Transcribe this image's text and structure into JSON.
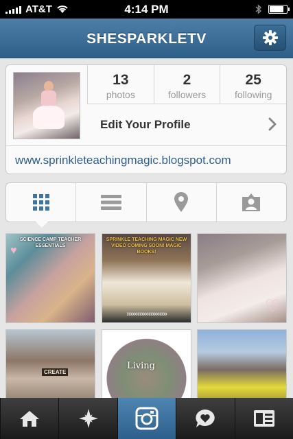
{
  "status_bar": {
    "carrier": "AT&T",
    "time": "4:14 PM",
    "battery_level": 0.82
  },
  "navbar": {
    "title": "SHESPARKLETV",
    "settings_icon": "gear-icon"
  },
  "profile": {
    "stats": [
      {
        "value": "13",
        "label": "photos"
      },
      {
        "value": "2",
        "label": "followers"
      },
      {
        "value": "25",
        "label": "following"
      }
    ],
    "edit_label": "Edit Your Profile",
    "website": "www.sprinkleteachingmagic.blogspot.com"
  },
  "view_tabs": {
    "icons": [
      "grid-icon",
      "list-icon",
      "location-pin-icon",
      "tagged-person-icon"
    ],
    "active": "grid-icon"
  },
  "photos": [
    {
      "caption": "SCIENCE CAMP TEACHER ESSENTIALS"
    },
    {
      "caption": "SPRINKLE TEACHING MAGIC NEW VIDEO COMING SOON! MAGIC BOOKS!"
    },
    {
      "caption": ""
    },
    {
      "caption": "",
      "sign": "CREATE"
    },
    {
      "caption": "",
      "overlay": "Living"
    },
    {
      "caption": ""
    }
  ],
  "tab_bar": {
    "icons": [
      "home-icon",
      "explore-star-icon",
      "camera-icon",
      "news-heart-icon",
      "profile-card-icon"
    ],
    "active": "camera-icon"
  },
  "colors": {
    "nav_blue": "#3a6b93",
    "link_blue": "#2d5d8a",
    "accent_active": "#3f75a3"
  }
}
